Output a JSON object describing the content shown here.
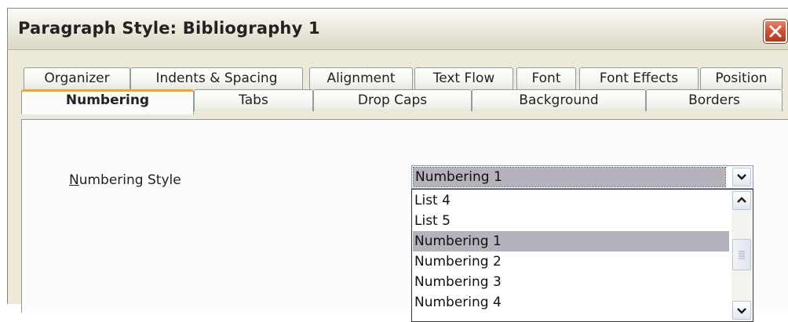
{
  "window": {
    "title": "Paragraph Style: Bibliography 1",
    "close_icon": "close-icon"
  },
  "tabs_row1": [
    {
      "label": "Organizer"
    },
    {
      "label": "Indents & Spacing"
    },
    {
      "label": "Alignment"
    },
    {
      "label": "Text Flow"
    },
    {
      "label": "Font"
    },
    {
      "label": "Font Effects"
    },
    {
      "label": "Position"
    }
  ],
  "tabs_row2": [
    {
      "label": "Numbering",
      "active": true
    },
    {
      "label": "Tabs"
    },
    {
      "label": "Drop Caps"
    },
    {
      "label": "Background"
    },
    {
      "label": "Borders"
    }
  ],
  "numbering": {
    "label_prefix": "N",
    "label_rest": "umbering Style",
    "selected_value": "Numbering 1",
    "options": [
      "List 4",
      "List 5",
      "Numbering 1",
      "Numbering 2",
      "Numbering 3",
      "Numbering 4"
    ],
    "highlighted_option": "Numbering 1"
  },
  "colors": {
    "active_tab_accent": "#f5a623",
    "selection": "#b4b3bc",
    "close_button": "#cf4a2b"
  }
}
